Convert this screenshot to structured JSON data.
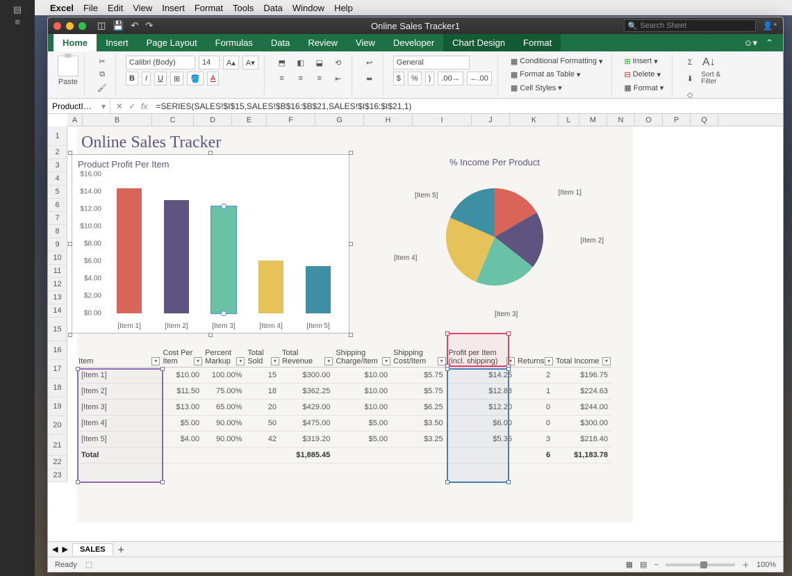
{
  "menubar": {
    "app": "Excel",
    "items": [
      "File",
      "Edit",
      "View",
      "Insert",
      "Format",
      "Tools",
      "Data",
      "Window",
      "Help"
    ]
  },
  "titlebar": {
    "doc": "Online Sales Tracker1",
    "search_placeholder": "Search Sheet"
  },
  "tabs": {
    "items": [
      "Home",
      "Insert",
      "Page Layout",
      "Formulas",
      "Data",
      "Review",
      "View",
      "Developer"
    ],
    "chart_tabs": [
      "Chart Design",
      "Format"
    ]
  },
  "ribbon": {
    "paste": "Paste",
    "font_name": "Calibri (Body)",
    "font_size": "14",
    "number_format": "General",
    "cond_fmt": "Conditional Formatting",
    "fmt_table": "Format as Table",
    "cell_styles": "Cell Styles",
    "insert": "Insert",
    "delete": "Delete",
    "format": "Format",
    "sort_filter": "Sort &\nFilter"
  },
  "namebox": "ProductI…",
  "formula": "=SERIES(SALES!$I$15,SALES!$B$16:$B$21,SALES!$I$16:$I$21,1)",
  "cols": [
    "A",
    "B",
    "C",
    "D",
    "E",
    "F",
    "G",
    "H",
    "I",
    "J",
    "K",
    "L",
    "M",
    "N",
    "O",
    "P",
    "Q"
  ],
  "rows": [
    "1",
    "2",
    "3",
    "4",
    "5",
    "6",
    "7",
    "8",
    "9",
    "10",
    "11",
    "12",
    "13",
    "14",
    "15",
    "16",
    "17",
    "18",
    "19",
    "20",
    "21",
    "22",
    "23"
  ],
  "page_title": "Online Sales Tracker",
  "chart_data": [
    {
      "type": "bar",
      "title": "Product Profit Per Item",
      "categories": [
        "[Item 1]",
        "[Item 2]",
        "[Item 3]",
        "[Item 4]",
        "[Item 5]"
      ],
      "values": [
        14.25,
        12.88,
        12.2,
        6.0,
        5.35
      ],
      "ylabel": "",
      "ylim": [
        0,
        16
      ],
      "yticks": [
        "$0.00",
        "$2.00",
        "$4.00",
        "$6.00",
        "$8.00",
        "$10.00",
        "$12.00",
        "$14.00",
        "$16.00"
      ],
      "colors": [
        "#d96459",
        "#5f5480",
        "#6ac2a6",
        "#e6c25a",
        "#3e8fa3"
      ],
      "selected_index": 2
    },
    {
      "type": "pie",
      "title": "% Income Per Product",
      "categories": [
        "[Item 1]",
        "[Item 2]",
        "[Item 3]",
        "[Item 4]",
        "[Item 5]"
      ],
      "values": [
        196.75,
        224.63,
        244.0,
        300.0,
        218.4
      ],
      "colors": [
        "#d96459",
        "#5f5480",
        "#6ac2a6",
        "#e6c25a",
        "#3e8fa3"
      ]
    }
  ],
  "table": {
    "headers": [
      "Item",
      "Cost Per Item",
      "Percent Markup",
      "Total Sold",
      "Total Revenue",
      "Shipping Charge/Item",
      "Shipping Cost/Item",
      "Profit per Item (incl. shipping)",
      "Returns",
      "Total Income"
    ],
    "rows": [
      [
        "[Item 1]",
        "$10.00",
        "100.00%",
        "15",
        "$300.00",
        "$10.00",
        "$5.75",
        "$14.25",
        "2",
        "$196.75"
      ],
      [
        "[Item 2]",
        "$11.50",
        "75.00%",
        "18",
        "$362.25",
        "$10.00",
        "$5.75",
        "$12.88",
        "1",
        "$224.63"
      ],
      [
        "[Item 3]",
        "$13.00",
        "65.00%",
        "20",
        "$429.00",
        "$10.00",
        "$6.25",
        "$12.20",
        "0",
        "$244.00"
      ],
      [
        "[Item 4]",
        "$5.00",
        "90.00%",
        "50",
        "$475.00",
        "$5.00",
        "$3.50",
        "$6.00",
        "0",
        "$300.00"
      ],
      [
        "[Item 5]",
        "$4.00",
        "90.00%",
        "42",
        "$319.20",
        "$5.00",
        "$3.25",
        "$5.35",
        "3",
        "$218.40"
      ]
    ],
    "total": [
      "Total",
      "",
      "",
      "",
      "$1,885.45",
      "",
      "",
      "",
      "6",
      "$1,183.78"
    ]
  },
  "sheet_tab": "SALES",
  "status": {
    "ready": "Ready",
    "zoom": "100%"
  }
}
